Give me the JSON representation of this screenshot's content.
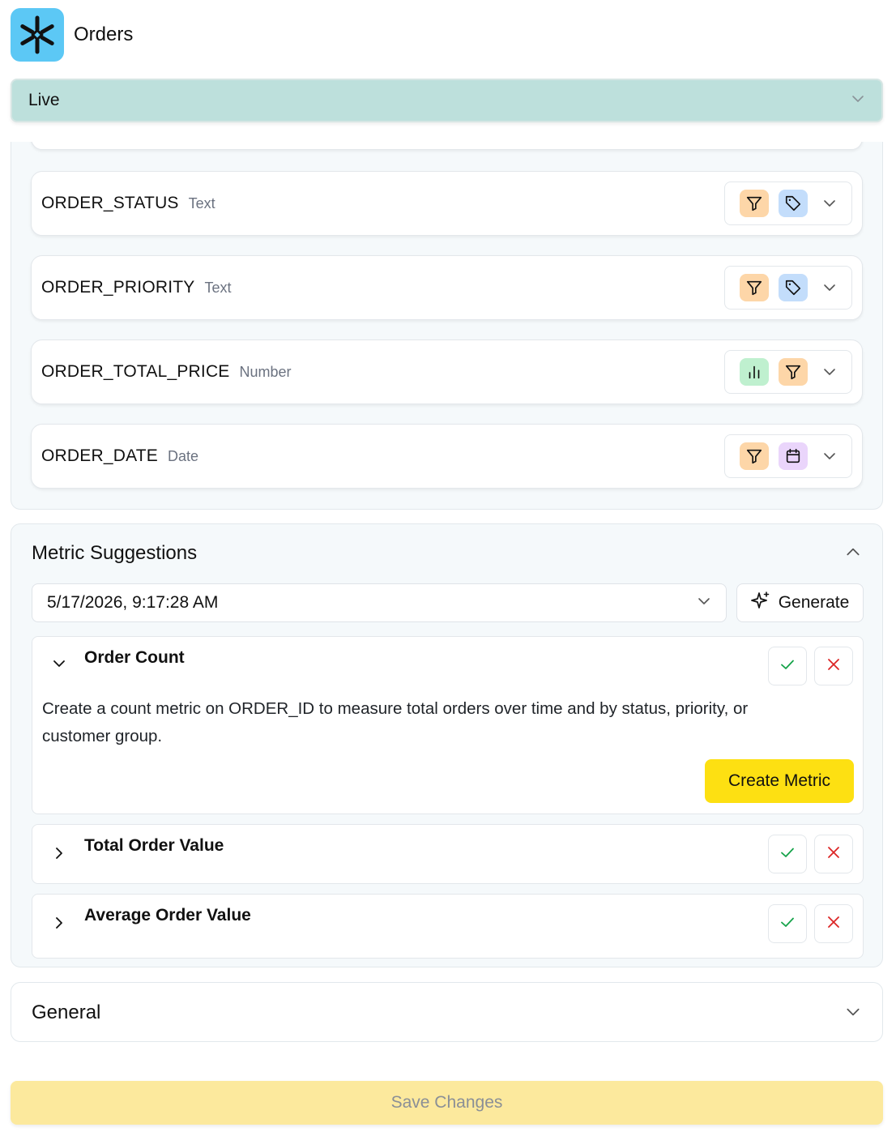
{
  "app": {
    "title": "Orders",
    "logo_icon": "snowflake-icon",
    "logo_color": "#5cc8f5"
  },
  "environment": {
    "selected": "Live"
  },
  "fields": [
    {
      "name": "ORDER_STATUS",
      "type": "Text",
      "tags": [
        "filter-icon",
        "tag-icon"
      ]
    },
    {
      "name": "ORDER_PRIORITY",
      "type": "Text",
      "tags": [
        "filter-icon",
        "tag-icon"
      ]
    },
    {
      "name": "ORDER_TOTAL_PRICE",
      "type": "Number",
      "tags": [
        "bar-chart-icon",
        "filter-icon"
      ]
    },
    {
      "name": "ORDER_DATE",
      "type": "Date",
      "tags": [
        "filter-icon",
        "calendar-icon"
      ]
    }
  ],
  "metric_suggestions": {
    "title": "Metric Suggestions",
    "run_timestamp": "5/17/2026, 9:17:28 AM",
    "generate_label": "Generate",
    "items": [
      {
        "title": "Order Count",
        "expanded": true,
        "description": "Create a count metric on ORDER_ID to measure total orders over time and by status, priority, or customer group.",
        "action_label": "Create Metric"
      },
      {
        "title": "Total Order Value",
        "expanded": false
      },
      {
        "title": "Average Order Value",
        "expanded": false
      }
    ]
  },
  "general": {
    "title": "General"
  },
  "footer": {
    "save_label": "Save Changes"
  },
  "colors": {
    "accent_yellow": "#fde012",
    "env_bg": "#bde0dc",
    "accept": "#16a34a",
    "reject": "#dc2626"
  }
}
